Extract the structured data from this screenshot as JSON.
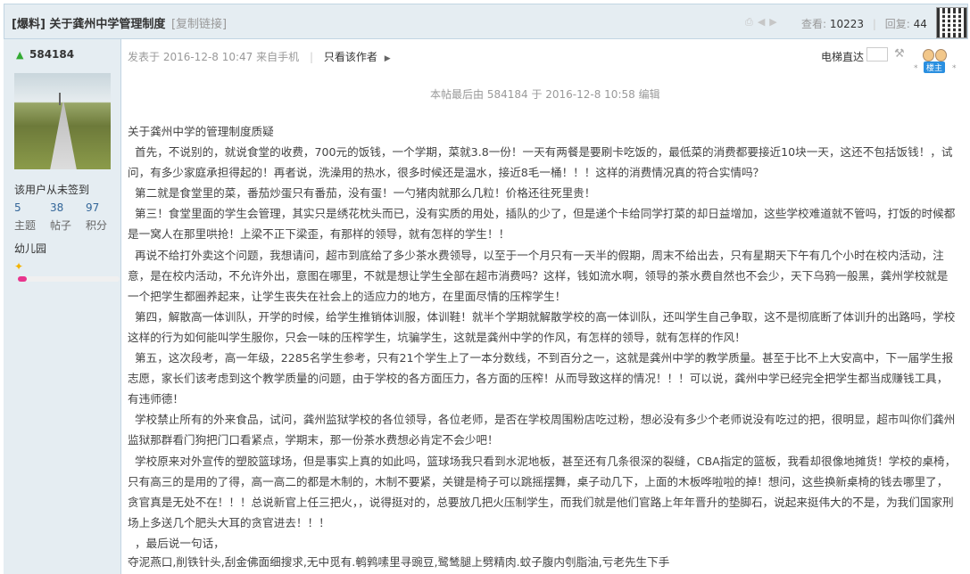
{
  "header": {
    "category": "[爆料]",
    "title": "关于龚州中学管理制度",
    "copy_link": "[复制链接]",
    "views_label": "查看:",
    "views": "10223",
    "replies_label": "回复:",
    "replies": "44"
  },
  "user": {
    "name": "584184",
    "signin": "该用户从未签到",
    "stats": [
      {
        "num": "5",
        "label": "主题"
      },
      {
        "num": "38",
        "label": "帖子"
      },
      {
        "num": "97",
        "label": "积分"
      }
    ],
    "level": "幼儿园",
    "level_progress": 0.09
  },
  "post_meta": {
    "published": "发表于 2016-12-8 10:47 来自手机",
    "author_only": "只看该作者",
    "elevator": "电梯直达",
    "louzhu": "楼主",
    "edited": "本帖最后由 584184 于 2016-12-8 10:58 编辑"
  },
  "post": {
    "body": "关于龚州中学的管理制度质疑\n  首先，不说别的，就说食堂的收费，700元的饭钱，一个学期，菜就3.8一份！一天有两餐是要刷卡吃饭的，最低菜的消费都要接近10块一天，这还不包括饭钱！，试问，有多少家庭承担得起的！再者说，洗澡用的热水，很多时候还是温水，接近8毛一桶！！！这样的消费情况真的符合实情吗？\n  第二就是食堂里的菜，番茄炒蛋只有番茄，没有蛋！一勺猪肉就那么几粒！价格还往死里贵！\n  第三！食堂里面的学生会管理，其实只是绣花枕头而已，没有实质的用处，插队的少了，但是递个卡给同学打菜的却日益增加，这些学校难道就不管吗，打饭的时候都是一窝人在那里哄抢！上梁不正下梁歪，有那样的领导，就有怎样的学生！！\n  再说不给打外卖这个问题，我想请问，超市到底给了多少茶水费领导，以至于一个月只有一天半的假期，周末不给出去，只有星期天下午有几个小时在校内活动，注意，是在校内活动，不允许外出，意图在哪里，不就是想让学生全部在超市消费吗？这样，钱如流水啊，领导的茶水费自然也不会少，天下乌鸦一般黑，龚州学校就是一个把学生都圈养起来，让学生丧失在社会上的适应力的地方，在里面尽情的压榨学生！\n  第四，解散高一体训队，开学的时候，给学生推销体训服，体训鞋！就半个学期就解散学校的高一体训队，还叫学生自己争取，这不是彻底断了体训升的出路吗，学校这样的行为如何能叫学生服你，只会一味的压榨学生，坑骗学生，这就是龚州中学的作风，有怎样的领导，就有怎样的作风！\n  第五，这次段考，高一年级，2285名学生参考，只有21个学生上了一本分数线，不到百分之一，这就是龚州中学的教学质量。甚至于比不上大安高中，下一届学生报志愿，家长们该考虑到这个教学质量的问题，由于学校的各方面压力，各方面的压榨！从而导致这样的情况！！！可以说，龚州中学已经完全把学生都当成赚钱工具，有违师德！\n  学校禁止所有的外来食品，试问，龚州监狱学校的各位领导，各位老师，是否在学校周围粉店吃过粉，想必没有多少个老师说没有吃过的把，很明显，超市叫你们龚州监狱那群看门狗把门口看紧点，学期末，那一份茶水费想必肯定不会少吧！\n  学校原来对外宣传的塑胶篮球场，但是事实上真的如此吗，篮球场我只看到水泥地板，甚至还有几条很深的裂缝，CBA指定的篮板，我看却很像地摊货！学校的桌椅，只有高三的是用的了得，高一高二的都是木制的，木制不要紧，关键是椅子可以跳摇摆舞，桌子动几下，上面的木板哗啦啦的掉！想问，这些换新桌椅的钱去哪里了，贪官真是无处不在！！！总说新官上任三把火，，说得挺对的，总要放几把火压制学生，而我们就是他们官路上年年晋升的垫脚石，说起来挺伟大的不是，为我们国家刑场上多送几个肥头大耳的贪官进去！！！\n  ，最后说一句话，",
    "signature": "夺泥燕口,削铁针头,刮金佛面细搜求,无中觅有.鹌鹑嗉里寻豌豆,鹭鸶腿上劈精肉.蚊子腹内刳脂油,亏老先生下手"
  },
  "colors": {
    "header_bg": "#e5edf2",
    "border": "#c2d5e3",
    "progress": "#e8358d",
    "star": "#f3b300",
    "stat_num": "#336699"
  }
}
